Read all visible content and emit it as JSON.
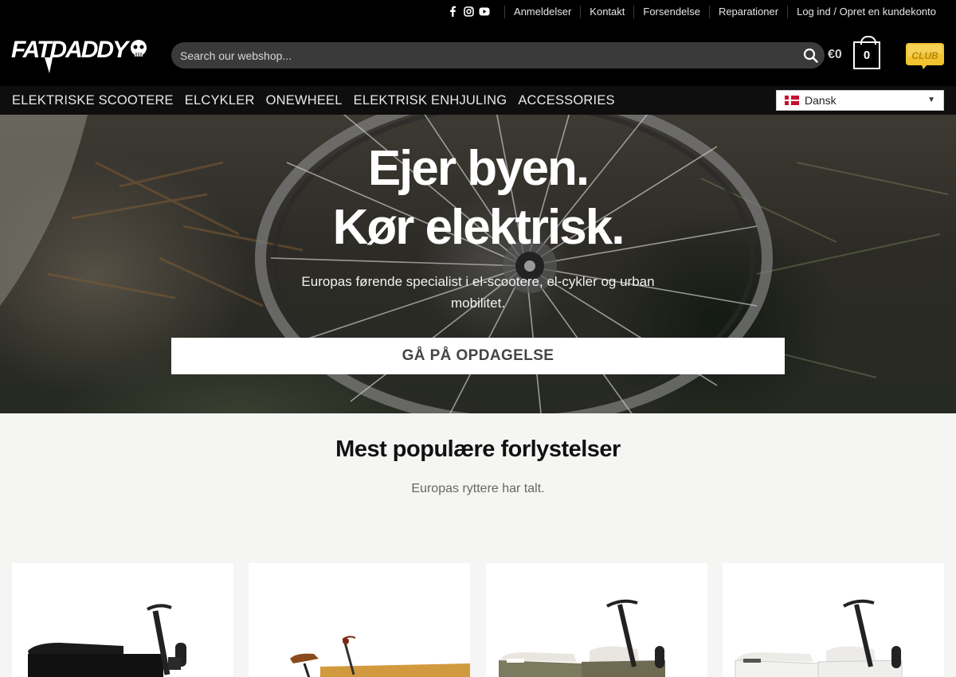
{
  "topbar": {
    "social": [
      "facebook-icon",
      "instagram-icon",
      "youtube-icon"
    ],
    "links": [
      "Anmeldelser",
      "Kontakt",
      "Forsendelse",
      "Reparationer",
      "Log ind / Opret en kundekonto"
    ]
  },
  "header": {
    "logo_text": "FATDADDY",
    "search_placeholder": "Search our webshop...",
    "cart_total": "€0",
    "cart_count": "0",
    "club_badge": "CLUB"
  },
  "catnav": {
    "items": [
      "ELEKTRISKE SCOOTERE",
      "ELCYKLER",
      "ONEWHEEL",
      "ELEKTRISK ENHJULING",
      "ACCESSORIES"
    ],
    "language": "Dansk"
  },
  "hero": {
    "title_line1": "Ejer byen.",
    "title_line2": "Kør elektrisk.",
    "subtitle": "Europas førende specialist i el-scootere, el-cykler og urban mobilitet.",
    "cta_label": "GÅ PÅ OPDAGELSE"
  },
  "popular": {
    "title": "Mest populære forlystelser",
    "subtitle": "Europas ryttere har talt."
  },
  "colors": {
    "topbar_bg": "#000000",
    "search_bg": "#3a3a3a",
    "page_bg": "#f5f5f3",
    "accent_gold": "#f2c230"
  }
}
